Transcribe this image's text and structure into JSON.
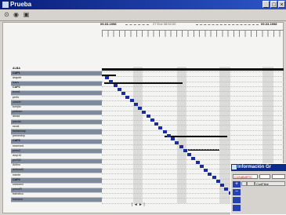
{
  "window": {
    "title": "Prueba"
  },
  "toolbar": {
    "icons": [
      "open-icon",
      "save-icon",
      "print-icon"
    ]
  },
  "timeline": {
    "start_date": "09-03-1998",
    "end_date": "09-03-1998",
    "center_label": "27  Ene  08:52:00"
  },
  "rows": [
    {
      "label": "ALBA",
      "group": true
    },
    {
      "label": "CAP1",
      "group": true
    },
    {
      "label": "drapeb",
      "group": false
    },
    {
      "label": "trans",
      "group": false
    },
    {
      "label": "CAP2",
      "group": true
    },
    {
      "label": "bomA",
      "group": false
    },
    {
      "label": "perfo",
      "group": false
    },
    {
      "label": "cancel",
      "group": false
    },
    {
      "label": "turnjilo",
      "group": false
    },
    {
      "label": "peticion",
      "group": false
    },
    {
      "label": "dread",
      "group": false
    },
    {
      "label": "parcial",
      "group": false
    },
    {
      "label": "secst",
      "group": false
    },
    {
      "label": "fantasmap",
      "group": false
    },
    {
      "label": "preventvp",
      "group": false
    },
    {
      "label": "CAP3",
      "group": true
    },
    {
      "label": "reserved",
      "group": false
    },
    {
      "label": "perfo2",
      "group": false
    },
    {
      "label": "dorp10",
      "group": false
    },
    {
      "label": "preSt2",
      "group": false
    },
    {
      "label": "Activo",
      "group": false
    },
    {
      "label": "definedC",
      "group": false
    },
    {
      "label": "Interfe",
      "group": false
    },
    {
      "label": "CAP4",
      "group": true
    },
    {
      "label": "sneseed",
      "group": false
    },
    {
      "label": "precoFI",
      "group": false
    },
    {
      "label": "transbco",
      "group": false
    },
    {
      "label": "transeur",
      "group": false
    }
  ],
  "pager": {
    "label": "| ◄ ► |"
  },
  "info_window": {
    "title": "Información Gr",
    "code": "C1S4B4RTC",
    "tab_label": "CodFilial"
  }
}
